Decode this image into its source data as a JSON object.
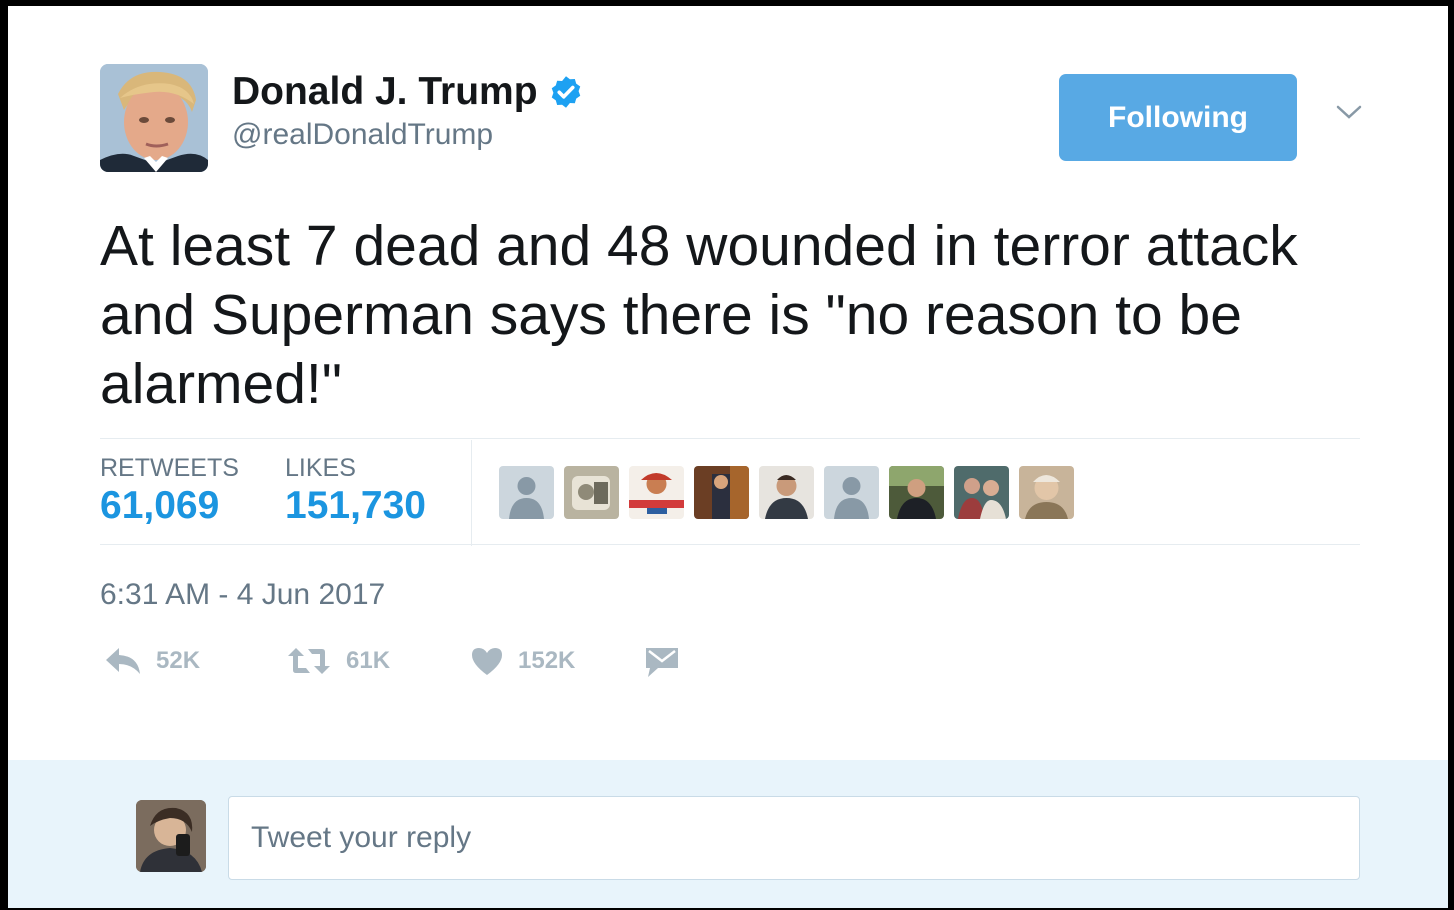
{
  "header": {
    "display_name": "Donald J. Trump",
    "handle": "@realDonaldTrump",
    "follow_label": "Following"
  },
  "tweet": {
    "text": "At least 7 dead and 48 wounded in terror attack and Superman says there is \"no reason to be alarmed!\""
  },
  "stats": {
    "retweets_label": "RETWEETS",
    "retweets_value": "61,069",
    "likes_label": "LIKES",
    "likes_value": "151,730"
  },
  "timestamp": "6:31 AM - 4 Jun 2017",
  "actions": {
    "reply_count": "52K",
    "retweet_count": "61K",
    "like_count": "152K"
  },
  "reply": {
    "placeholder": "Tweet your reply"
  },
  "colors": {
    "accent": "#1b95e0",
    "follow_button": "#58a9e4",
    "secondary_text": "#657786",
    "action_icons": "#aab8c2",
    "reply_area_bg": "#e8f4fb"
  },
  "icons": [
    "verified-badge-icon",
    "chevron-down-icon",
    "reply-icon",
    "retweet-icon",
    "heart-icon",
    "direct-message-icon"
  ]
}
